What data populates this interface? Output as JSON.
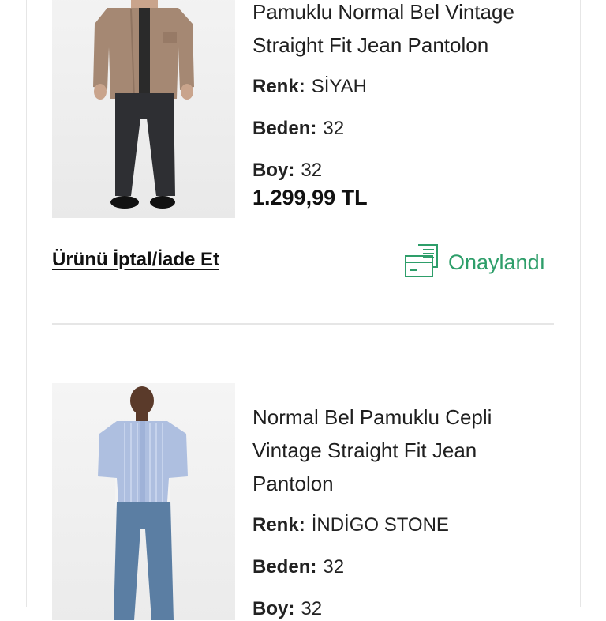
{
  "orders": [
    {
      "product_name_lines": [
        "Pamuklu Normal Bel Vintage",
        "Straight Fit Jean Pantolon"
      ],
      "renk_label": "Renk:",
      "renk_value": "SİYAH",
      "beden_label": "Beden:",
      "beden_value": "32",
      "boy_label": "Boy:",
      "boy_value": "32",
      "price": "1.299,99 TL",
      "action_label": "Ürünü İptal/İade Et",
      "status_label": "Onaylandı",
      "status_icon": "receipt-icon",
      "status_color": "#2e9e6a"
    },
    {
      "product_name_lines": [
        "Normal Bel Pamuklu Cepli",
        "Vintage Straight Fit Jean",
        "Pantolon"
      ],
      "renk_label": "Renk:",
      "renk_value": "İNDİGO STONE",
      "beden_label": "Beden:",
      "beden_value": "32",
      "boy_label": "Boy:",
      "boy_value": "32"
    }
  ]
}
